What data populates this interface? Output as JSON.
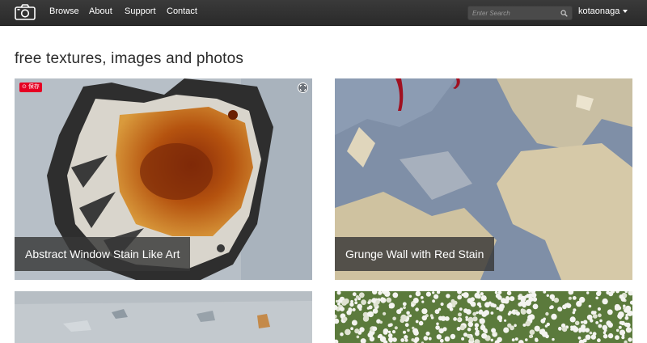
{
  "nav": {
    "links": [
      "Browse",
      "About",
      "Support",
      "Contact"
    ],
    "search_placeholder": "Enter Search",
    "username": "kotaonaga"
  },
  "page": {
    "title": "free textures, images and photos"
  },
  "cards": [
    {
      "caption": "Abstract Window Stain Like Art",
      "save_label": "保存"
    },
    {
      "caption": "Grunge Wall with Red Stain"
    },
    {
      "caption": ""
    },
    {
      "caption": ""
    }
  ],
  "colors": {
    "navbar": "#2f2f2f",
    "save_badge": "#e60023",
    "caption_bg": "#373737"
  }
}
